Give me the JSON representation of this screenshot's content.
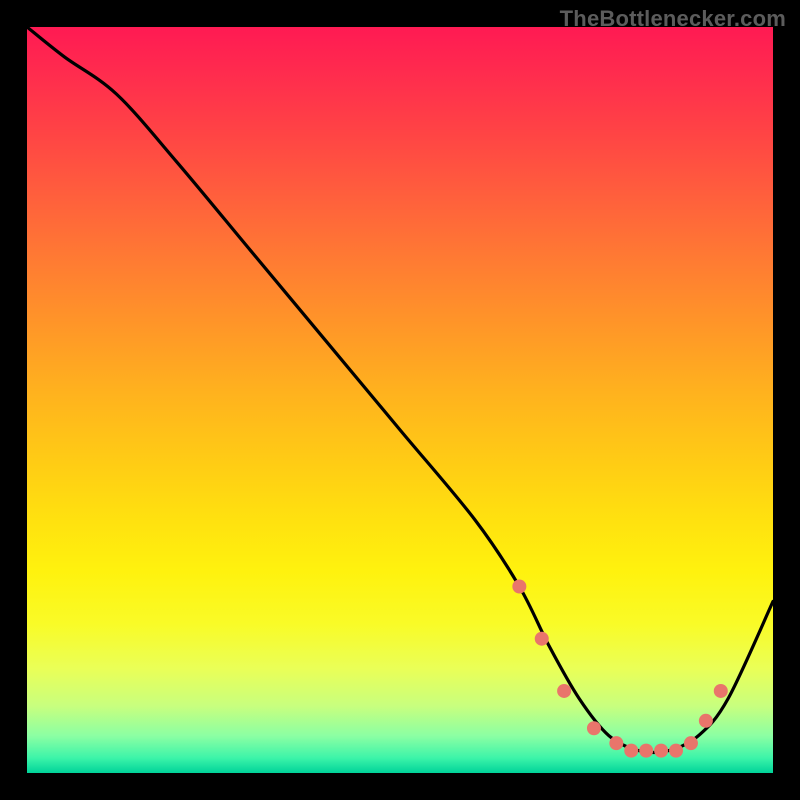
{
  "watermark": "TheBottlenecker.com",
  "chart_data": {
    "type": "line",
    "title": "",
    "xlabel": "",
    "ylabel": "",
    "xlim": [
      0,
      100
    ],
    "ylim": [
      0,
      100
    ],
    "series": [
      {
        "name": "bottleneck-curve",
        "x": [
          0,
          5,
          12,
          20,
          30,
          40,
          50,
          60,
          66,
          70,
          74,
          78,
          82,
          86,
          90,
          94,
          100
        ],
        "y": [
          100,
          96,
          91,
          82,
          70,
          58,
          46,
          34,
          25,
          17,
          10,
          5,
          3,
          3,
          5,
          10,
          23
        ]
      }
    ],
    "markers": {
      "name": "highlight-points",
      "x": [
        66,
        69,
        72,
        76,
        79,
        81,
        83,
        85,
        87,
        89,
        91,
        93
      ],
      "y": [
        25,
        18,
        11,
        6,
        4,
        3,
        3,
        3,
        3,
        4,
        7,
        11
      ]
    },
    "background_gradient": {
      "stops": [
        {
          "pos": 0.0,
          "color": "#ff1a53"
        },
        {
          "pos": 0.5,
          "color": "#ffc018"
        },
        {
          "pos": 0.8,
          "color": "#f6ff2e"
        },
        {
          "pos": 1.0,
          "color": "#00d39a"
        }
      ]
    }
  }
}
